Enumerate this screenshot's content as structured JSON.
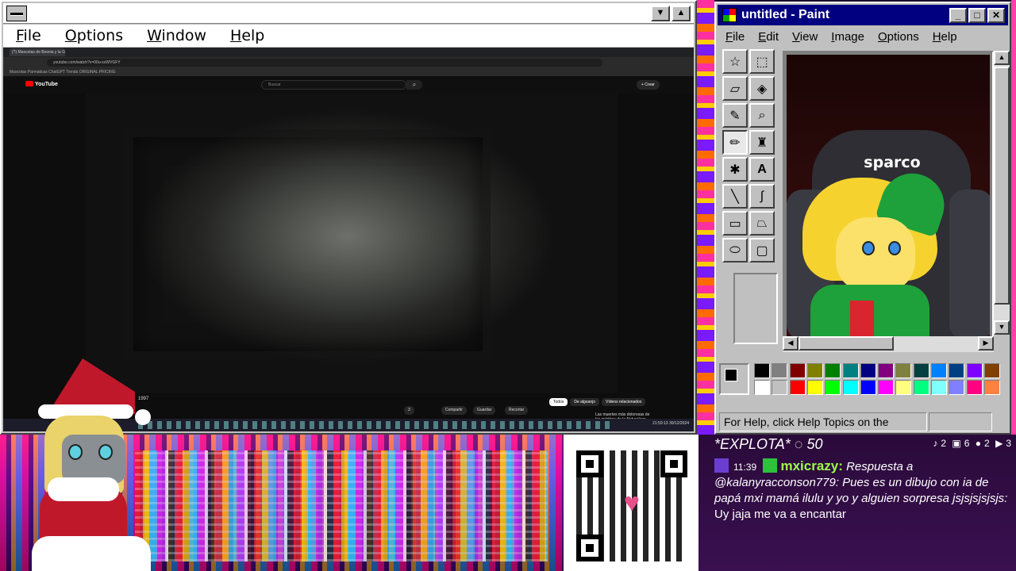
{
  "left_window": {
    "menu": [
      "File",
      "Options",
      "Window",
      "Help"
    ],
    "browser": {
      "tab_title": "(?) Mascotas de Bosnia y la G...",
      "url": "youtube.com/watch?v=00u-xxWVGFY",
      "bookmarks": "Mascotas Parmaticas     ChatGPT     Tienda     ORIGINAL PRICING",
      "yt_logo": "YouTube",
      "search_placeholder": "Buscar",
      "create_label": "+ Crear",
      "video_title": "1997",
      "actions": [
        "3",
        "Compartir",
        "Guardar",
        "Recortar"
      ],
      "chips": [
        "Todos",
        "De algoanjo",
        "Vídeos relacionados"
      ],
      "related": "Las muertes más dolorosas de los mártires de la Naturaleza",
      "taskbar_search": "Buscar",
      "clock_time": "21:59:13",
      "clock_date": "30/12/2024"
    }
  },
  "paint": {
    "title": "untitled - Paint",
    "menu": [
      "File",
      "Edit",
      "View",
      "Image",
      "Options",
      "Help"
    ],
    "status": "For Help, click Help Topics on the",
    "chair_logo": "sparco",
    "palette_top": [
      "#000000",
      "#808080",
      "#800000",
      "#808000",
      "#008000",
      "#008080",
      "#000080",
      "#800080",
      "#808040",
      "#004040",
      "#0080ff",
      "#004080",
      "#8000ff",
      "#804000"
    ],
    "palette_bottom": [
      "#ffffff",
      "#c0c0c0",
      "#ff0000",
      "#ffff00",
      "#00ff00",
      "#00ffff",
      "#0000ff",
      "#ff00ff",
      "#ffff80",
      "#00ff80",
      "#80ffff",
      "#8080ff",
      "#ff0080",
      "#ff8040"
    ]
  },
  "chat": {
    "header": "*EXPLOTA*",
    "header_count": "50",
    "stats": [
      "2",
      "6",
      "2",
      "3"
    ],
    "time": "11:39",
    "user": "mxicrazy:",
    "reply_prefix": "Respuesta a",
    "reply_text": "@kalanyracconson779: Pues es un dibujo con ia de papá mxi mamá ilulu y yo y alguien sorpresa",
    "sub_user": "jsjsjsjsjsjs:",
    "message": "Uy jaja me va a encantar"
  }
}
